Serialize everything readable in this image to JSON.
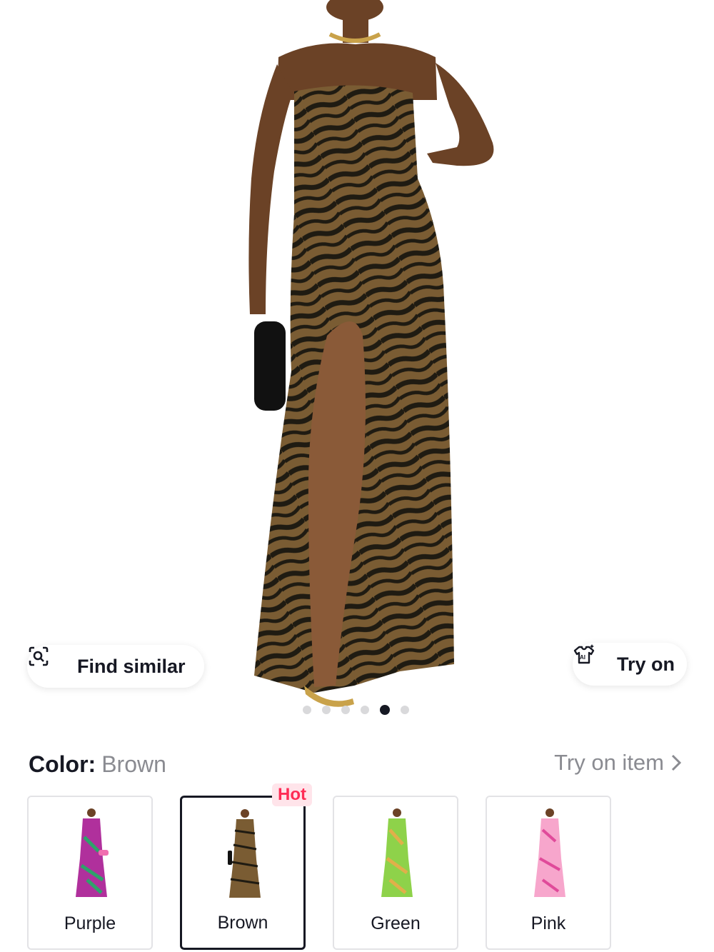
{
  "actions": {
    "find_similar": "Find similar",
    "try_on": "Try on"
  },
  "carousel": {
    "total": 6,
    "active_index": 5
  },
  "color": {
    "label": "Color:",
    "selected": "Brown",
    "try_on_item": "Try on item"
  },
  "swatches": [
    {
      "label": "Purple",
      "selected": false,
      "badge": ""
    },
    {
      "label": "Brown",
      "selected": true,
      "badge": "Hot"
    },
    {
      "label": "Green",
      "selected": false,
      "badge": ""
    },
    {
      "label": "Pink",
      "selected": false,
      "badge": ""
    }
  ],
  "colors": {
    "accent": "#fe2c55",
    "badge_bg": "#ffe4ea",
    "text_primary": "#161823",
    "text_secondary": "#8a8b91",
    "dress_brown": "#7a5c33",
    "stripe_dark": "#1f1b12"
  }
}
